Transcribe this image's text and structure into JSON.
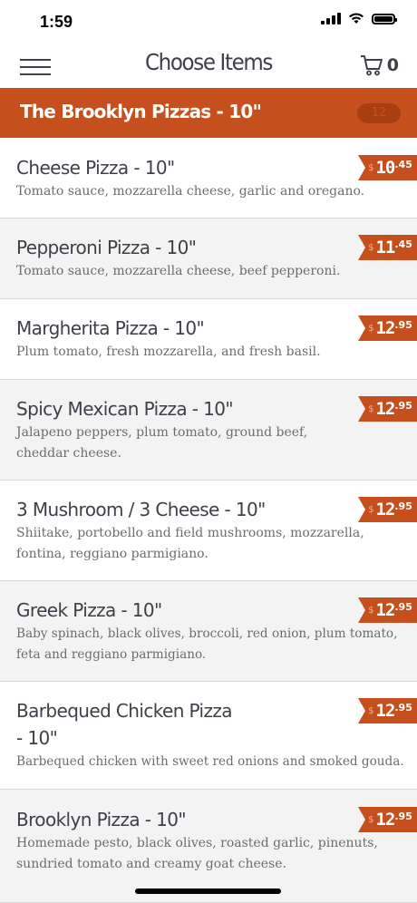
{
  "status_bar": {
    "time": "1:59"
  },
  "nav": {
    "title": "Choose Items",
    "cart_count": "0",
    "menu_icon": "hamburger-icon",
    "cart_icon": "cart-icon"
  },
  "category": {
    "title": "The Brooklyn Pizzas - 10\"",
    "badge": "12"
  },
  "colors": {
    "accent": "#c5501d",
    "text": "#3d4048",
    "description": "#6d6d6d"
  },
  "items": [
    {
      "name": "Cheese Pizza - 10\"",
      "description": "Tomato sauce, mozzarella cheese, garlic and oregano.",
      "price_currency": "$",
      "price_whole": "10",
      "price_cents": ".45"
    },
    {
      "name": "Pepperoni Pizza - 10\"",
      "description": "Tomato sauce, mozzarella cheese, beef pepperoni.",
      "price_currency": "$",
      "price_whole": "11",
      "price_cents": ".45"
    },
    {
      "name": "Margherita Pizza - 10\"",
      "description": "Plum tomato, fresh mozzarella, and fresh basil.",
      "price_currency": "$",
      "price_whole": "12",
      "price_cents": ".95"
    },
    {
      "name": "Spicy Mexican Pizza - 10\"",
      "description": "Jalapeno peppers, plum tomato, ground beef, cheddar cheese.",
      "price_currency": "$",
      "price_whole": "12",
      "price_cents": ".95"
    },
    {
      "name": "3 Mushroom / 3 Cheese - 10\"",
      "description": "Shiitake, portobello and field mushrooms, mozzarella, fontina, reggiano parmigiano.",
      "price_currency": "$",
      "price_whole": "12",
      "price_cents": ".95"
    },
    {
      "name": "Greek Pizza - 10\"",
      "description": "Baby spinach, black olives, broccoli, red onion, plum tomato, feta and reggiano parmigiano.",
      "price_currency": "$",
      "price_whole": "12",
      "price_cents": ".95"
    },
    {
      "name": "Barbequed Chicken Pizza - 10\"",
      "description": "Barbequed chicken with sweet red onions and smoked gouda.",
      "price_currency": "$",
      "price_whole": "12",
      "price_cents": ".95"
    },
    {
      "name": "Brooklyn Pizza - 10\"",
      "description": "Homemade pesto, black olives, roasted garlic, pinenuts, sundried tomato and creamy goat cheese.",
      "price_currency": "$",
      "price_whole": "12",
      "price_cents": ".95"
    }
  ]
}
